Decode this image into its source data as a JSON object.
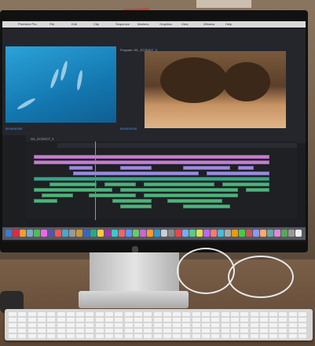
{
  "scene": "video editing workstation on a desk",
  "app": {
    "menu": [
      "Premiere Pro",
      "File",
      "Edit",
      "Clip",
      "Sequence",
      "Markers",
      "Graphics",
      "View",
      "Window",
      "Help"
    ],
    "source_panel_label": "Source: WL_ECSHOT",
    "program_panel_label": "Program: WL_ECSHOT_3",
    "timeline_label": "WL_ECSHOT_3",
    "timecode_left": "00:00:00:00",
    "timecode_right": "00:00:00:00"
  },
  "colors": {
    "clip_pink": "#c57fd0",
    "clip_purple": "#9b8be0",
    "clip_green": "#4fb37a",
    "clip_teal": "#3aa38a",
    "accent_blue": "#5aa0ff",
    "sticky_note": "#d23a3a"
  },
  "dock_icon_colors": [
    "#3a7bd5",
    "#e24",
    "#f0a030",
    "#7ac",
    "#5b5",
    "#e6e",
    "#55a",
    "#f55",
    "#4ac",
    "#999",
    "#c93",
    "#36c",
    "#2a8",
    "#fc3",
    "#a3a",
    "#3cc",
    "#e66",
    "#59f",
    "#6c6",
    "#c6c",
    "#f93",
    "#39c",
    "#ccc",
    "#888",
    "#e44",
    "#7af",
    "#5c8",
    "#dd5",
    "#b6f",
    "#f77",
    "#4bd",
    "#aaa",
    "#e90",
    "#4c4",
    "#c55",
    "#89f",
    "#fa6",
    "#6aa",
    "#d8d",
    "#5a5",
    "#999",
    "#eee"
  ]
}
